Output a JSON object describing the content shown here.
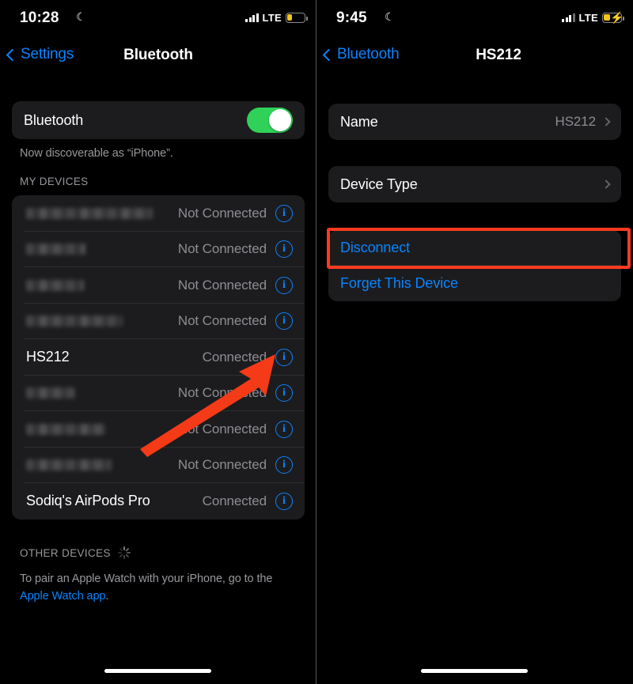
{
  "left_panel": {
    "status_bar": {
      "time": "10:28",
      "moon_icon": "crescent-moon-icon",
      "signal_icon": "cellular-signal-icon",
      "signal_bars": 4,
      "carrier": "LTE",
      "battery_icon": "battery-low-icon",
      "battery_level_pct": 25,
      "battery_color": "#f5c518",
      "battery_charging": false
    },
    "nav": {
      "back_label": "Settings",
      "back_icon": "chevron-left-icon",
      "title": "Bluetooth"
    },
    "bluetooth_toggle": {
      "label": "Bluetooth",
      "state": "on",
      "accent_color": "#30d158"
    },
    "discoverable_note": "Now discoverable as “iPhone”.",
    "my_devices_header": "MY DEVICES",
    "devices": [
      {
        "name": "",
        "redacted": true,
        "redacted_width": 160,
        "status": "Not Connected",
        "info_icon": "info-circle-icon"
      },
      {
        "name": "",
        "redacted": true,
        "redacted_width": 75,
        "status": "Not Connected",
        "info_icon": "info-circle-icon"
      },
      {
        "name": "",
        "redacted": true,
        "redacted_width": 73,
        "status": "Not Connected",
        "info_icon": "info-circle-icon"
      },
      {
        "name": "",
        "redacted": true,
        "redacted_width": 122,
        "status": "Not Connected",
        "info_icon": "info-circle-icon"
      },
      {
        "name": "HS212",
        "redacted": false,
        "redacted_width": 0,
        "status": "Connected",
        "info_icon": "info-circle-icon"
      },
      {
        "name": "",
        "redacted": true,
        "redacted_width": 62,
        "status": "Not Connected",
        "info_icon": "info-circle-icon"
      },
      {
        "name": "",
        "redacted": true,
        "redacted_width": 100,
        "status": "Not Connected",
        "info_icon": "info-circle-icon"
      },
      {
        "name": "",
        "redacted": true,
        "redacted_width": 108,
        "status": "Not Connected",
        "info_icon": "info-circle-icon"
      },
      {
        "name": "Sodiq's AirPods Pro",
        "redacted": false,
        "redacted_width": 0,
        "status": "Connected",
        "info_icon": "info-circle-icon"
      }
    ],
    "other_devices_header": "OTHER DEVICES",
    "other_devices_spinner": "activity-spinner-icon",
    "apple_watch_note_line1": "To pair an Apple Watch with your iPhone, go to the",
    "apple_watch_link": "Apple Watch app",
    "apple_watch_note_end": "."
  },
  "right_panel": {
    "status_bar": {
      "time": "9:45",
      "moon_icon": "crescent-moon-icon",
      "signal_icon": "cellular-signal-icon",
      "signal_bars": 3,
      "carrier": "LTE",
      "battery_icon": "battery-charging-icon",
      "battery_level_pct": 35,
      "battery_color": "#f5c518",
      "battery_charging": true,
      "bolt_glyph": "⚡"
    },
    "nav": {
      "back_label": "Bluetooth",
      "back_icon": "chevron-left-icon",
      "title": "HS212"
    },
    "rows": [
      {
        "label": "Name",
        "value": "HS212",
        "chevron": "chevron-right-icon"
      },
      {
        "label": "Device Type",
        "value": "",
        "chevron": "chevron-right-icon"
      }
    ],
    "actions": [
      {
        "label": "Disconnect",
        "highlighted": true
      },
      {
        "label": "Forget This Device",
        "highlighted": false
      }
    ]
  },
  "annotations": {
    "highlight_color": "#ff3b1f",
    "arrow_color": "#f53a17",
    "arrow_name": "red-pointer-arrow",
    "highlight_name": "red-highlight-box"
  }
}
